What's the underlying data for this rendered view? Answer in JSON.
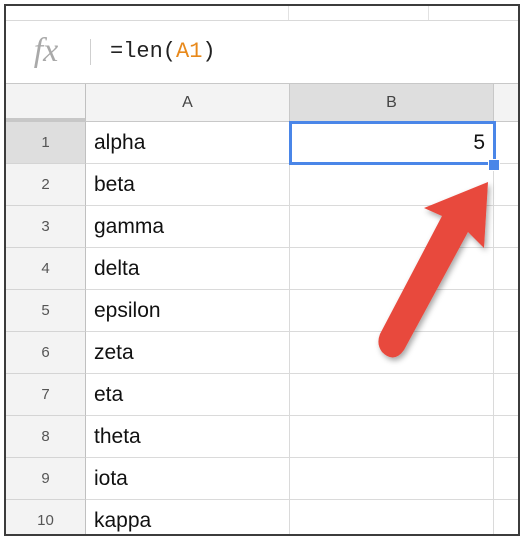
{
  "formula_bar": {
    "fx_label": "fx",
    "formula_prefix": "=len(",
    "formula_ref": "A1",
    "formula_suffix": ")"
  },
  "columns": [
    "A",
    "B"
  ],
  "rows": [
    {
      "num": "1",
      "a": "alpha",
      "b": "5"
    },
    {
      "num": "2",
      "a": "beta",
      "b": ""
    },
    {
      "num": "3",
      "a": "gamma",
      "b": ""
    },
    {
      "num": "4",
      "a": "delta",
      "b": ""
    },
    {
      "num": "5",
      "a": "epsilon",
      "b": ""
    },
    {
      "num": "6",
      "a": "zeta",
      "b": ""
    },
    {
      "num": "7",
      "a": "eta",
      "b": ""
    },
    {
      "num": "8",
      "a": "theta",
      "b": ""
    },
    {
      "num": "9",
      "a": "iota",
      "b": ""
    },
    {
      "num": "10",
      "a": "kappa",
      "b": ""
    }
  ],
  "selection": {
    "cell": "B1"
  },
  "colors": {
    "selection": "#4a86e8",
    "formula_ref": "#e8891b",
    "arrow": "#e8483d"
  },
  "annotation": {
    "icon": "red-arrow-icon"
  }
}
